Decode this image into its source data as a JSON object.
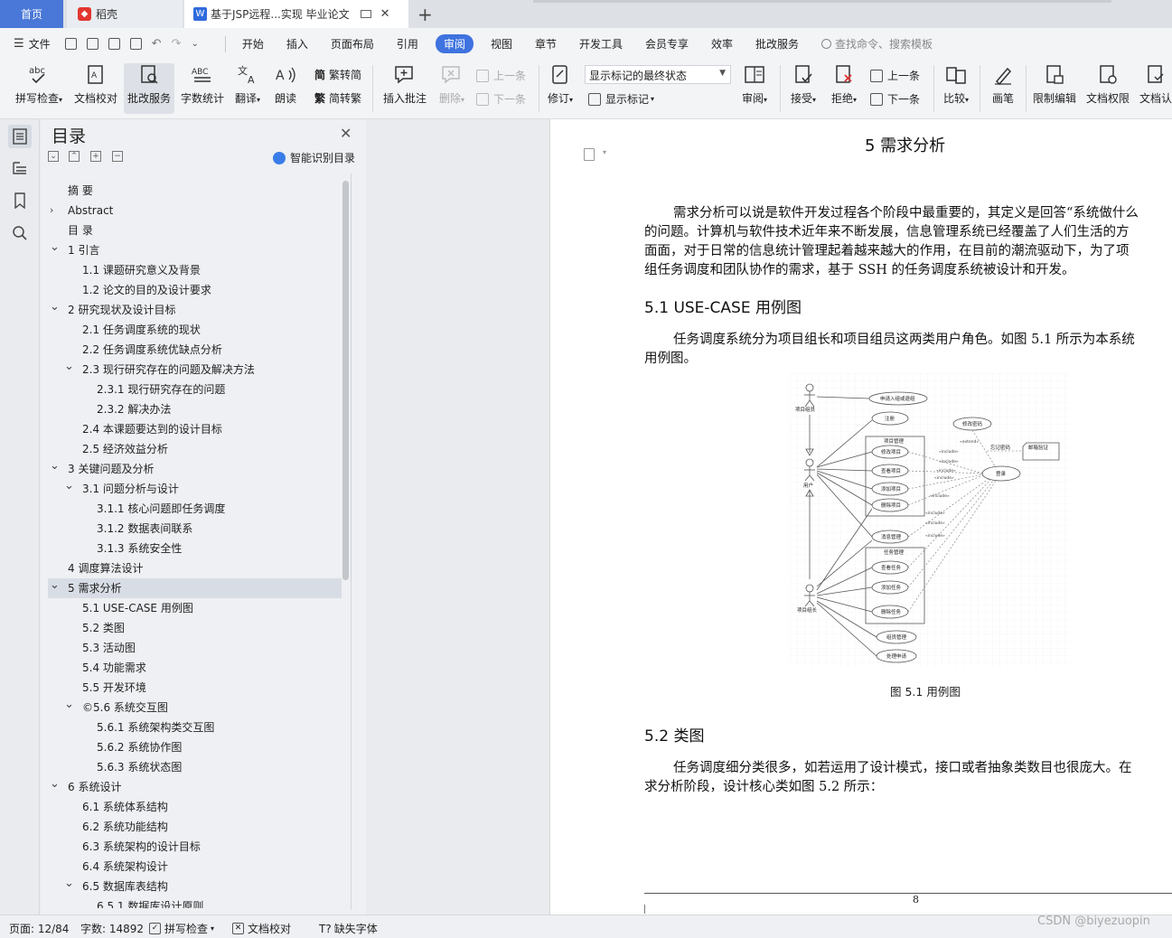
{
  "tabs": {
    "home": "首页",
    "daoke": "稻壳",
    "doc": "基于JSP远程...实现 毕业论文",
    "add": "+"
  },
  "menu": {
    "file": "文件",
    "items": [
      "开始",
      "插入",
      "页面布局",
      "引用",
      "审阅",
      "视图",
      "章节",
      "开发工具",
      "会员专享",
      "效率",
      "批改服务"
    ],
    "active": "审阅",
    "search": "查找命令、搜索模板"
  },
  "ribbon": {
    "spell": "拼写检查",
    "doc_check": "文档校对",
    "correct": "批改服务",
    "word_count": "字数统计",
    "translate": "翻译",
    "read": "朗读",
    "to_trad": "繁转简",
    "to_simp": "简转繁",
    "insert_comment": "插入批注",
    "delete": "删除",
    "prev_comment": "上一条",
    "next_comment": "下一条",
    "track": "修订",
    "markup_state": "显示标记的最终状态",
    "show_markup": "显示标记",
    "review": "审阅",
    "accept": "接受",
    "reject": "拒绝",
    "prev_change": "上一条",
    "next_change": "下一条",
    "compare": "比较",
    "ink": "画笔",
    "restrict": "限制编辑",
    "permission": "文档权限",
    "certify": "文档认"
  },
  "toc": {
    "title": "目录",
    "ai_label": "智能识别目录",
    "items": [
      {
        "text": "摘  要",
        "level": 0,
        "chev": ""
      },
      {
        "text": "Abstract",
        "level": 0,
        "chev": "right"
      },
      {
        "text": "目  录",
        "level": 0,
        "chev": ""
      },
      {
        "text": "1   引言",
        "level": 0,
        "chev": "down"
      },
      {
        "text": "1.1   课题研究意义及背景",
        "level": 1,
        "chev": ""
      },
      {
        "text": "1.2   论文的目的及设计要求",
        "level": 1,
        "chev": ""
      },
      {
        "text": "2   研究现状及设计目标",
        "level": 0,
        "chev": "down"
      },
      {
        "text": "2.1   任务调度系统的现状",
        "level": 1,
        "chev": ""
      },
      {
        "text": "2.2   任务调度系统优缺点分析",
        "level": 1,
        "chev": ""
      },
      {
        "text": "2.3 现行研究存在的问题及解决方法",
        "level": 1,
        "chev": "down"
      },
      {
        "text": "2.3.1   现行研究存在的问题",
        "level": 2,
        "chev": ""
      },
      {
        "text": "2.3.2   解决办法",
        "level": 2,
        "chev": ""
      },
      {
        "text": "2.4   本课题要达到的设计目标",
        "level": 1,
        "chev": ""
      },
      {
        "text": "2.5   经济效益分析",
        "level": 1,
        "chev": ""
      },
      {
        "text": "3   关键问题及分析",
        "level": 0,
        "chev": "down"
      },
      {
        "text": "3.1   问题分析与设计",
        "level": 1,
        "chev": "down"
      },
      {
        "text": "3.1.1   核心问题即任务调度",
        "level": 2,
        "chev": ""
      },
      {
        "text": "3.1.2   数据表间联系",
        "level": 2,
        "chev": ""
      },
      {
        "text": "3.1.3   系统安全性",
        "level": 2,
        "chev": ""
      },
      {
        "text": "4   调度算法设计",
        "level": 0,
        "chev": ""
      },
      {
        "text": "5   需求分析",
        "level": 0,
        "chev": "down",
        "selected": true
      },
      {
        "text": "5.1   USE-CASE 用例图",
        "level": 1,
        "chev": ""
      },
      {
        "text": "5.2   类图",
        "level": 1,
        "chev": ""
      },
      {
        "text": "5.3   活动图",
        "level": 1,
        "chev": ""
      },
      {
        "text": "5.4   功能需求",
        "level": 1,
        "chev": ""
      },
      {
        "text": "5.5   开发环境",
        "level": 1,
        "chev": ""
      },
      {
        "text": "©5.6   系统交互图",
        "level": 1,
        "chev": "down"
      },
      {
        "text": "5.6.1   系统架构类交互图",
        "level": 2,
        "chev": ""
      },
      {
        "text": "5.6.2   系统协作图",
        "level": 2,
        "chev": ""
      },
      {
        "text": "5.6.3   系统状态图",
        "level": 2,
        "chev": ""
      },
      {
        "text": "6   系统设计",
        "level": 0,
        "chev": "down"
      },
      {
        "text": "6.1   系统体系结构",
        "level": 1,
        "chev": ""
      },
      {
        "text": "6.2   系统功能结构",
        "level": 1,
        "chev": ""
      },
      {
        "text": "6.3   系统架构的设计目标",
        "level": 1,
        "chev": ""
      },
      {
        "text": "6.4   系统架构设计",
        "level": 1,
        "chev": ""
      },
      {
        "text": "6.5   数据库表结构",
        "level": 1,
        "chev": "down"
      },
      {
        "text": "6.5.1   数据库设计原则",
        "level": 2,
        "chev": ""
      }
    ]
  },
  "doc": {
    "h1": "5   需求分析",
    "p1": [
      "需求分析可以说是软件开发过程各个阶段中最重要的，其定义是回答“系统做什么",
      "的问题。计算机与软件技术近年来不断发展，信息管理系统已经覆盖了人们生活的方",
      "面面，对于日常的信息统计管理起着越来越大的作用，在目前的潮流驱动下，为了项",
      "组任务调度和团队协作的需求，基于 SSH 的任务调度系统被设计和开发。"
    ],
    "h2_1": "5.1   USE-CASE 用例图",
    "p2": [
      "任务调度系统分为项目组长和项目组员这两类用户角色。如图 5.1 所示为本系统",
      "用例图。"
    ],
    "fig_caption": "图 5.1  用例图",
    "h2_2": "5.2   类图",
    "p3": [
      "任务调度细分类很多，如若运用了设计模式，接口或者抽象类数目也很庞大。在",
      "求分析阶段，设计核心类如图 5.2 所示："
    ],
    "page_number": "8"
  },
  "uml": {
    "actor_member": "项目组员",
    "actor_user": "用户",
    "actor_leader": "项目组长",
    "apply": "申请入组或退组",
    "register": "注册",
    "project_mgmt": "项目管理",
    "modify_project": "修改项目",
    "view_project": "查看项目",
    "add_project": "添加项目",
    "delete_project": "删除项目",
    "message_mgmt": "消息管理",
    "task_mgmt": "任务管理",
    "view_task": "查看任务",
    "add_task": "添加任务",
    "delete_task": "删除任务",
    "member_mgmt": "组员管理",
    "handle_apply": "处理申请",
    "change_pwd": "修改密码",
    "forgot_pwd": "忘记密码",
    "email_verify": "邮箱验证",
    "login": "登录",
    "include": "«include»",
    "extend": "«extend»"
  },
  "status": {
    "page": "页面: 12/84",
    "words": "字数: 14892",
    "spell": "拼写检查",
    "doc_check": "文档校对",
    "missing_font": "缺失字体",
    "watermark": "CSDN @biyezuopin"
  }
}
